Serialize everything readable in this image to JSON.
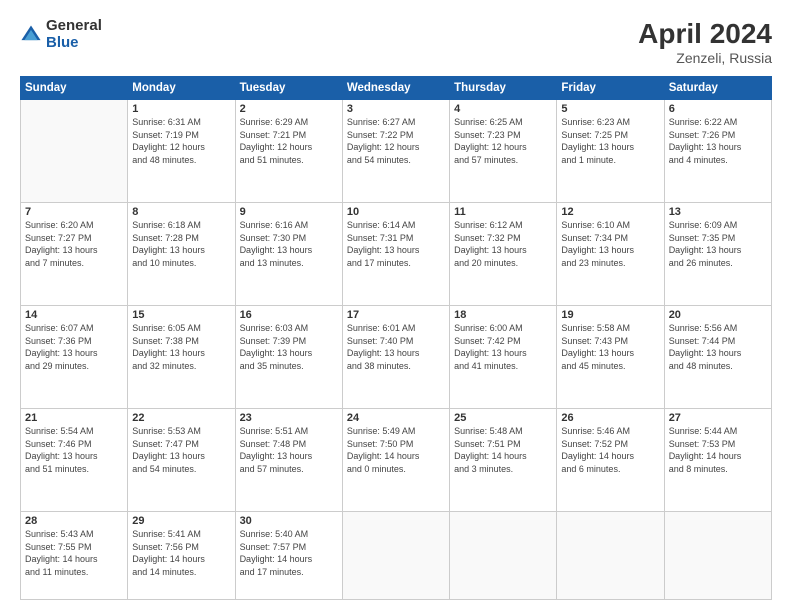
{
  "header": {
    "logo_general": "General",
    "logo_blue": "Blue",
    "title": "April 2024",
    "location": "Zenzeli, Russia"
  },
  "days_of_week": [
    "Sunday",
    "Monday",
    "Tuesday",
    "Wednesday",
    "Thursday",
    "Friday",
    "Saturday"
  ],
  "weeks": [
    [
      {
        "day": "",
        "info": ""
      },
      {
        "day": "1",
        "info": "Sunrise: 6:31 AM\nSunset: 7:19 PM\nDaylight: 12 hours\nand 48 minutes."
      },
      {
        "day": "2",
        "info": "Sunrise: 6:29 AM\nSunset: 7:21 PM\nDaylight: 12 hours\nand 51 minutes."
      },
      {
        "day": "3",
        "info": "Sunrise: 6:27 AM\nSunset: 7:22 PM\nDaylight: 12 hours\nand 54 minutes."
      },
      {
        "day": "4",
        "info": "Sunrise: 6:25 AM\nSunset: 7:23 PM\nDaylight: 12 hours\nand 57 minutes."
      },
      {
        "day": "5",
        "info": "Sunrise: 6:23 AM\nSunset: 7:25 PM\nDaylight: 13 hours\nand 1 minute."
      },
      {
        "day": "6",
        "info": "Sunrise: 6:22 AM\nSunset: 7:26 PM\nDaylight: 13 hours\nand 4 minutes."
      }
    ],
    [
      {
        "day": "7",
        "info": "Sunrise: 6:20 AM\nSunset: 7:27 PM\nDaylight: 13 hours\nand 7 minutes."
      },
      {
        "day": "8",
        "info": "Sunrise: 6:18 AM\nSunset: 7:28 PM\nDaylight: 13 hours\nand 10 minutes."
      },
      {
        "day": "9",
        "info": "Sunrise: 6:16 AM\nSunset: 7:30 PM\nDaylight: 13 hours\nand 13 minutes."
      },
      {
        "day": "10",
        "info": "Sunrise: 6:14 AM\nSunset: 7:31 PM\nDaylight: 13 hours\nand 17 minutes."
      },
      {
        "day": "11",
        "info": "Sunrise: 6:12 AM\nSunset: 7:32 PM\nDaylight: 13 hours\nand 20 minutes."
      },
      {
        "day": "12",
        "info": "Sunrise: 6:10 AM\nSunset: 7:34 PM\nDaylight: 13 hours\nand 23 minutes."
      },
      {
        "day": "13",
        "info": "Sunrise: 6:09 AM\nSunset: 7:35 PM\nDaylight: 13 hours\nand 26 minutes."
      }
    ],
    [
      {
        "day": "14",
        "info": "Sunrise: 6:07 AM\nSunset: 7:36 PM\nDaylight: 13 hours\nand 29 minutes."
      },
      {
        "day": "15",
        "info": "Sunrise: 6:05 AM\nSunset: 7:38 PM\nDaylight: 13 hours\nand 32 minutes."
      },
      {
        "day": "16",
        "info": "Sunrise: 6:03 AM\nSunset: 7:39 PM\nDaylight: 13 hours\nand 35 minutes."
      },
      {
        "day": "17",
        "info": "Sunrise: 6:01 AM\nSunset: 7:40 PM\nDaylight: 13 hours\nand 38 minutes."
      },
      {
        "day": "18",
        "info": "Sunrise: 6:00 AM\nSunset: 7:42 PM\nDaylight: 13 hours\nand 41 minutes."
      },
      {
        "day": "19",
        "info": "Sunrise: 5:58 AM\nSunset: 7:43 PM\nDaylight: 13 hours\nand 45 minutes."
      },
      {
        "day": "20",
        "info": "Sunrise: 5:56 AM\nSunset: 7:44 PM\nDaylight: 13 hours\nand 48 minutes."
      }
    ],
    [
      {
        "day": "21",
        "info": "Sunrise: 5:54 AM\nSunset: 7:46 PM\nDaylight: 13 hours\nand 51 minutes."
      },
      {
        "day": "22",
        "info": "Sunrise: 5:53 AM\nSunset: 7:47 PM\nDaylight: 13 hours\nand 54 minutes."
      },
      {
        "day": "23",
        "info": "Sunrise: 5:51 AM\nSunset: 7:48 PM\nDaylight: 13 hours\nand 57 minutes."
      },
      {
        "day": "24",
        "info": "Sunrise: 5:49 AM\nSunset: 7:50 PM\nDaylight: 14 hours\nand 0 minutes."
      },
      {
        "day": "25",
        "info": "Sunrise: 5:48 AM\nSunset: 7:51 PM\nDaylight: 14 hours\nand 3 minutes."
      },
      {
        "day": "26",
        "info": "Sunrise: 5:46 AM\nSunset: 7:52 PM\nDaylight: 14 hours\nand 6 minutes."
      },
      {
        "day": "27",
        "info": "Sunrise: 5:44 AM\nSunset: 7:53 PM\nDaylight: 14 hours\nand 8 minutes."
      }
    ],
    [
      {
        "day": "28",
        "info": "Sunrise: 5:43 AM\nSunset: 7:55 PM\nDaylight: 14 hours\nand 11 minutes."
      },
      {
        "day": "29",
        "info": "Sunrise: 5:41 AM\nSunset: 7:56 PM\nDaylight: 14 hours\nand 14 minutes."
      },
      {
        "day": "30",
        "info": "Sunrise: 5:40 AM\nSunset: 7:57 PM\nDaylight: 14 hours\nand 17 minutes."
      },
      {
        "day": "",
        "info": ""
      },
      {
        "day": "",
        "info": ""
      },
      {
        "day": "",
        "info": ""
      },
      {
        "day": "",
        "info": ""
      }
    ]
  ]
}
